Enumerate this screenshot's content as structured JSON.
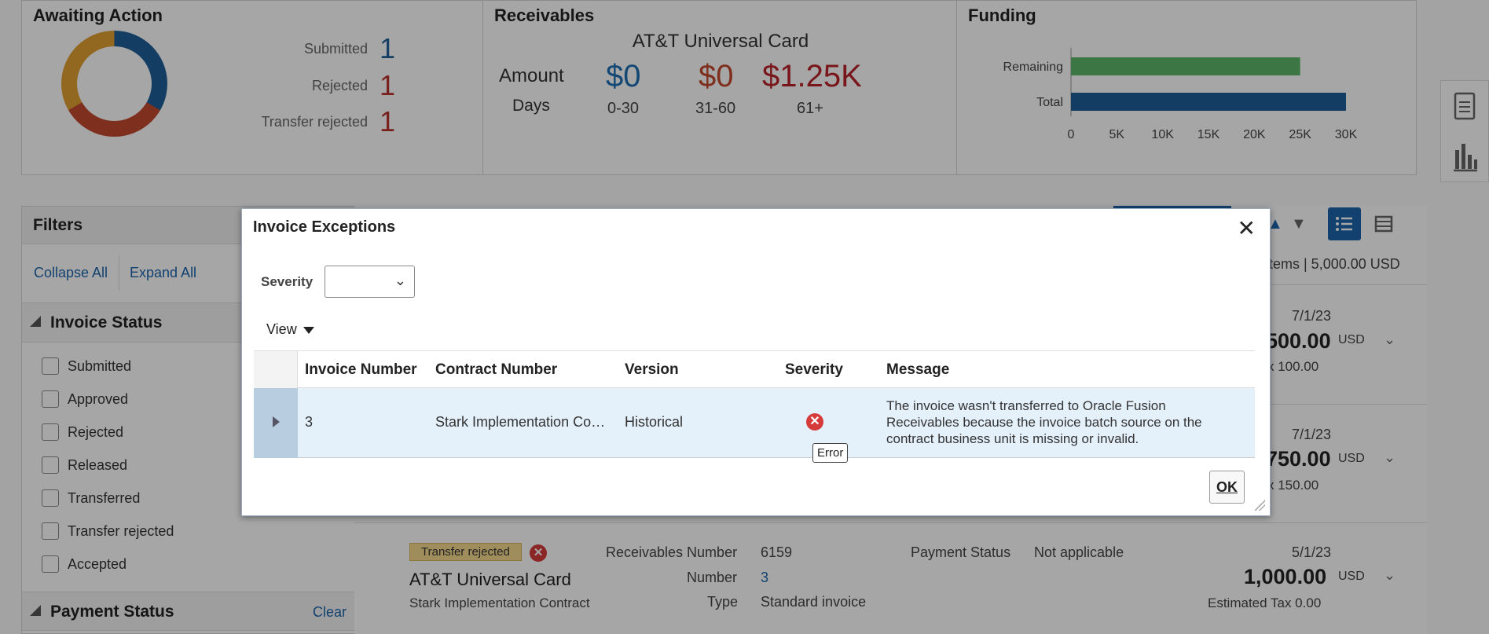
{
  "dashboard": {
    "awaiting": {
      "title": "Awaiting Action",
      "rows": [
        {
          "label": "Submitted",
          "count": "1",
          "color": "#1f5f99"
        },
        {
          "label": "Rejected",
          "count": "1",
          "color": "#b8322a"
        },
        {
          "label": "Transfer rejected",
          "count": "1",
          "color": "#b8322a"
        }
      ]
    },
    "receivables": {
      "title": "Receivables",
      "customer": "AT&T Universal Card",
      "amount_label": "Amount",
      "days_label": "Days",
      "buckets": [
        {
          "amount": "$0",
          "days": "0-30",
          "color": "#1f6fb3"
        },
        {
          "amount": "$0",
          "days": "31-60",
          "color": "#c4492d"
        },
        {
          "amount": "$1.25K",
          "days": "61+",
          "color": "#b8222a"
        }
      ]
    },
    "funding": {
      "title": "Funding"
    }
  },
  "chart_data": {
    "type": "bar",
    "orientation": "horizontal",
    "categories": [
      "Remaining",
      "Total"
    ],
    "values": [
      25000,
      30000
    ],
    "colors": [
      "#5cb56a",
      "#1f5f99"
    ],
    "xlim": [
      0,
      30000
    ],
    "xticks": [
      "0",
      "5K",
      "10K",
      "15K",
      "20K",
      "25K",
      "30K"
    ]
  },
  "filters": {
    "title": "Filters",
    "collapse_all": "Collapse All",
    "expand_all": "Expand All",
    "invoice_status": {
      "title": "Invoice Status",
      "options": [
        "Submitted",
        "Approved",
        "Rejected",
        "Released",
        "Transferred",
        "Transfer rejected",
        "Accepted"
      ]
    },
    "payment_status": {
      "title": "Payment Status",
      "clear": "Clear"
    }
  },
  "results": {
    "summary": "items | 5,000.00 USD",
    "rows": [
      {
        "date": "7/1/23",
        "amount": "500.00",
        "currency": "USD",
        "tax": "x  100.00"
      },
      {
        "date": "7/1/23",
        "amount": "750.00",
        "currency": "USD",
        "tax": "x  150.00"
      }
    ],
    "card": {
      "badge": "Transfer rejected",
      "customer": "AT&T Universal Card",
      "contract": "Stark Implementation Contract",
      "recv_label": "Receivables Number",
      "recv_value": "6159",
      "num_label": "Number",
      "num_value": "3",
      "type_label": "Type",
      "type_value": "Standard invoice",
      "pay_label": "Payment Status",
      "pay_value": "Not applicable",
      "date": "5/1/23",
      "amount": "1,000.00",
      "currency": "USD",
      "tax": "Estimated Tax  0.00"
    }
  },
  "dialog": {
    "title": "Invoice Exceptions",
    "severity_label": "Severity",
    "severity_value": "",
    "view_menu": "View",
    "columns": [
      "Invoice Number",
      "Contract Number",
      "Version",
      "Severity",
      "Message"
    ],
    "row": {
      "invoice_number": "3",
      "contract_number": "Stark Implementation Co…",
      "version": "Historical",
      "severity": "Error",
      "message": "The invoice wasn't transferred to Oracle Fusion Receivables because the invoice batch source on the contract business unit is missing or invalid."
    },
    "tooltip": "Error",
    "ok_label": "OK"
  }
}
